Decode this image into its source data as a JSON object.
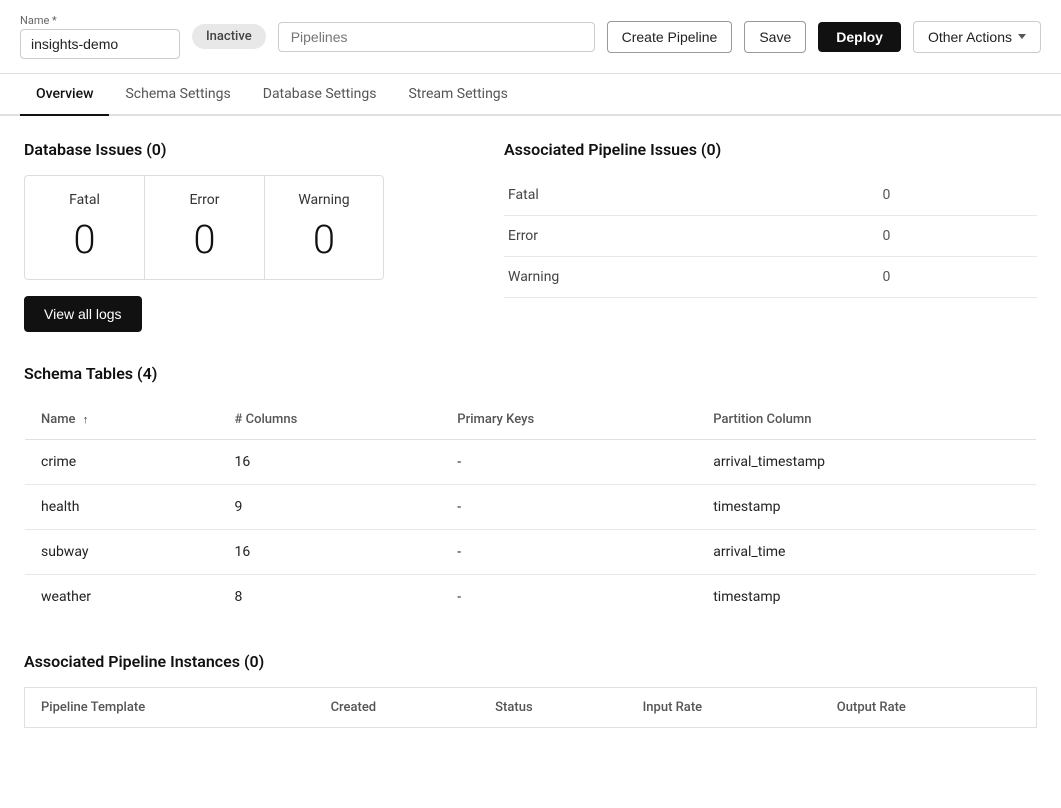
{
  "header": {
    "name_label": "Name *",
    "name_value": "insights-demo",
    "status_badge": "Inactive",
    "pipelines_placeholder": "Pipelines",
    "btn_create": "Create Pipeline",
    "btn_save": "Save",
    "btn_deploy": "Deploy",
    "btn_other_actions": "Other Actions"
  },
  "tabs": [
    {
      "id": "overview",
      "label": "Overview",
      "active": true
    },
    {
      "id": "schema-settings",
      "label": "Schema Settings",
      "active": false
    },
    {
      "id": "database-settings",
      "label": "Database Settings",
      "active": false
    },
    {
      "id": "stream-settings",
      "label": "Stream Settings",
      "active": false
    }
  ],
  "database_issues": {
    "title": "Database Issues (0)",
    "cards": [
      {
        "label": "Fatal",
        "value": "0"
      },
      {
        "label": "Error",
        "value": "0"
      },
      {
        "label": "Warning",
        "value": "0"
      }
    ],
    "view_logs_btn": "View all logs"
  },
  "associated_pipeline_issues": {
    "title": "Associated Pipeline Issues (0)",
    "rows": [
      {
        "label": "Fatal",
        "value": "0"
      },
      {
        "label": "Error",
        "value": "0"
      },
      {
        "label": "Warning",
        "value": "0"
      }
    ]
  },
  "schema_tables": {
    "title": "Schema Tables (4)",
    "columns": [
      {
        "id": "name",
        "label": "Name",
        "sortable": true,
        "sort_dir": "asc"
      },
      {
        "id": "columns",
        "label": "# Columns",
        "sortable": false
      },
      {
        "id": "primary_keys",
        "label": "Primary Keys",
        "sortable": false
      },
      {
        "id": "partition_column",
        "label": "Partition Column",
        "sortable": false
      }
    ],
    "rows": [
      {
        "name": "crime",
        "columns": "16",
        "primary_keys": "-",
        "partition_column": "arrival_timestamp"
      },
      {
        "name": "health",
        "columns": "9",
        "primary_keys": "-",
        "partition_column": "timestamp"
      },
      {
        "name": "subway",
        "columns": "16",
        "primary_keys": "-",
        "partition_column": "arrival_time"
      },
      {
        "name": "weather",
        "columns": "8",
        "primary_keys": "-",
        "partition_column": "timestamp"
      }
    ]
  },
  "pipeline_instances": {
    "title": "Associated Pipeline Instances (0)",
    "columns": [
      {
        "label": "Pipeline Template"
      },
      {
        "label": "Created"
      },
      {
        "label": "Status"
      },
      {
        "label": "Input Rate"
      },
      {
        "label": "Output Rate"
      }
    ]
  }
}
